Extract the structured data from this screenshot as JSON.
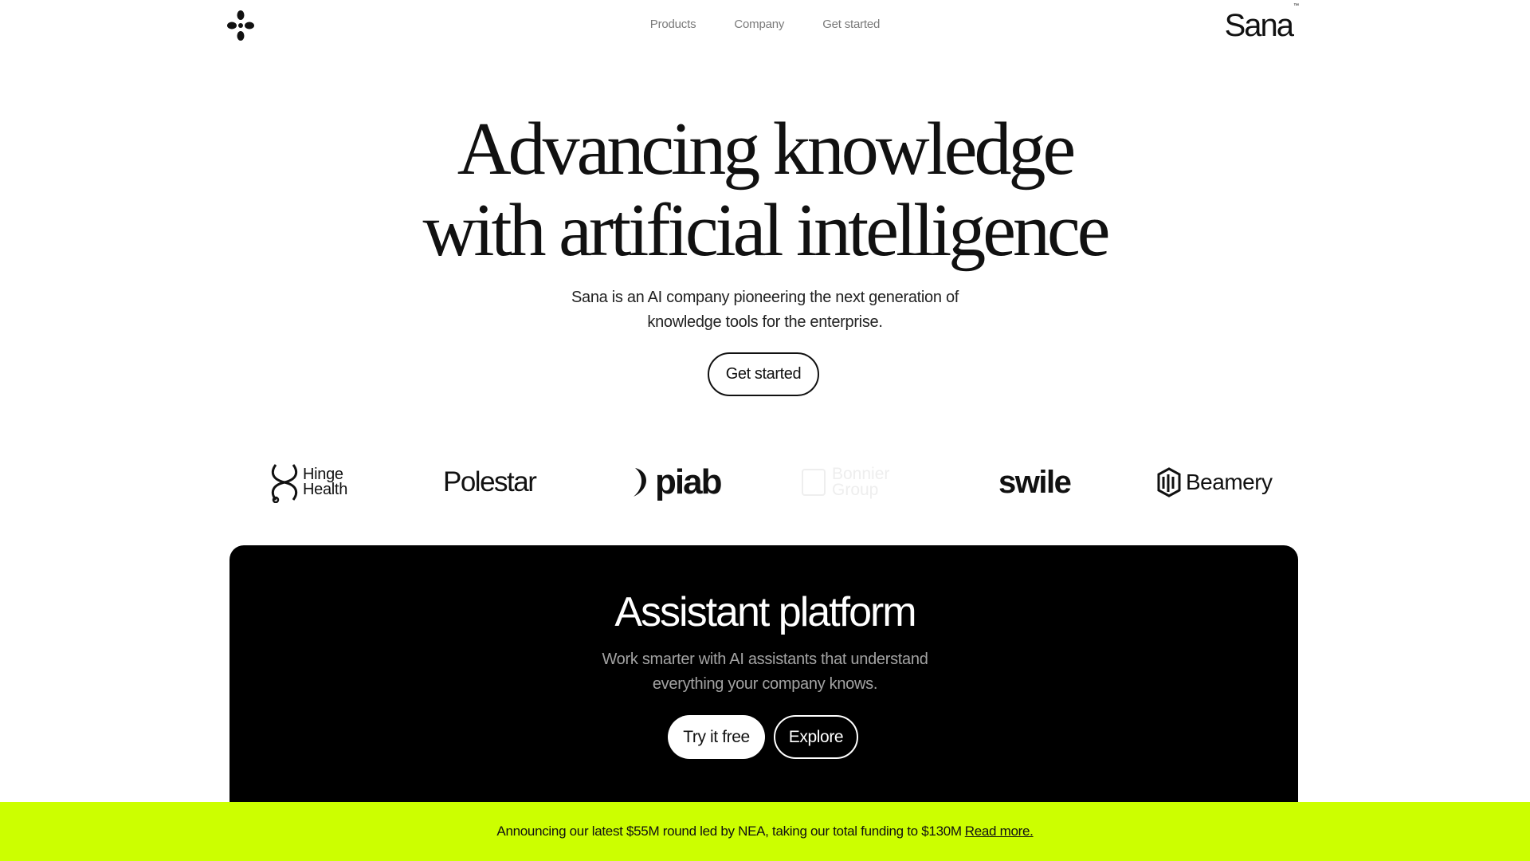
{
  "header": {
    "logo_icon": "four-petal-flower-icon",
    "nav": [
      {
        "label": "Products"
      },
      {
        "label": "Company"
      },
      {
        "label": "Get started"
      }
    ],
    "wordmark": "Sana",
    "trademark": "™"
  },
  "hero": {
    "title_line1": "Advancing knowledge",
    "title_line2": "with artificial intelligence",
    "subtitle_line1": "Sana is an AI company pioneering the next generation of",
    "subtitle_line2": "knowledge tools for the enterprise.",
    "cta_label": "Get started"
  },
  "logos": {
    "hinge_line1": "Hinge",
    "hinge_line2": "Health",
    "polestar": "Polestar",
    "piab": "piab",
    "faded_line1": "Bonnier",
    "faded_line2": "Group",
    "swile": "swile",
    "beamery": "Beamery"
  },
  "platform": {
    "title": "Assistant platform",
    "subtitle_line1": "Work smarter with AI assistants that understand",
    "subtitle_line2": "everything your company knows.",
    "try_label": "Try it free",
    "explore_label": "Explore"
  },
  "banner": {
    "text": "Announcing our latest $55M round led by NEA, taking our total funding to $130M",
    "link_label": "Read more."
  },
  "colors": {
    "banner_bg": "#ccff00",
    "card_bg": "#000000",
    "text": "#111111"
  }
}
